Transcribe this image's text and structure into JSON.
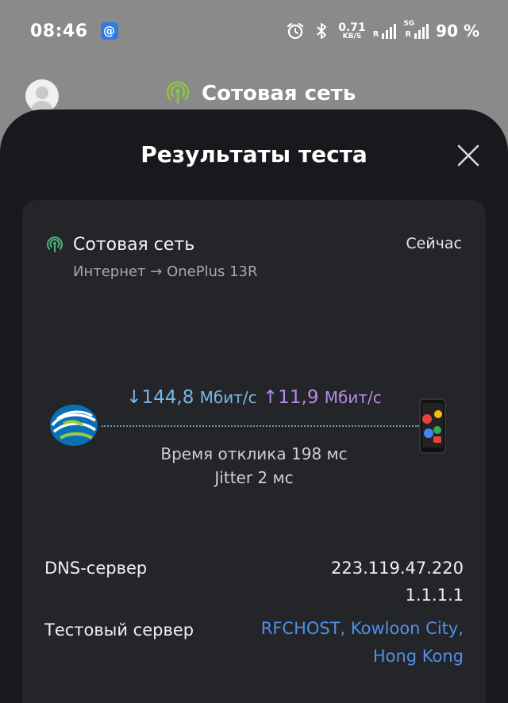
{
  "status_bar": {
    "time": "08:46",
    "app_badge": "@",
    "speed_value": "0.71",
    "speed_unit": "KB/S",
    "sim1_label": "R",
    "sim2_label": "R",
    "sim2_network": "5G",
    "battery": "90 %"
  },
  "background": {
    "title": "Сотовая сеть"
  },
  "sheet": {
    "title": "Результаты теста",
    "close_icon": "close-icon"
  },
  "result": {
    "network_name": "Сотовая сеть",
    "time": "Сейчас",
    "route": "Интернет → OnePlus 13R",
    "download_arrow": "↓",
    "download_value": "144,8",
    "download_unit": "Мбит/с",
    "upload_arrow": "↑",
    "upload_value": "11,9",
    "upload_unit": "Мбит/с",
    "latency": "Время отклика 198 мс",
    "jitter": "Jitter 2 мс"
  },
  "details": {
    "dns_label": "DNS-сервер",
    "dns_values": [
      "223.119.47.220",
      "1.1.1.1"
    ],
    "server_label": "Тестовый сервер",
    "server_value": "RFCHOST, Kowloon City, Hong Kong"
  },
  "colors": {
    "accent_green": "#4caf7a",
    "download": "#78b8e6",
    "upload": "#b78ae6",
    "link": "#4f8fe8"
  }
}
